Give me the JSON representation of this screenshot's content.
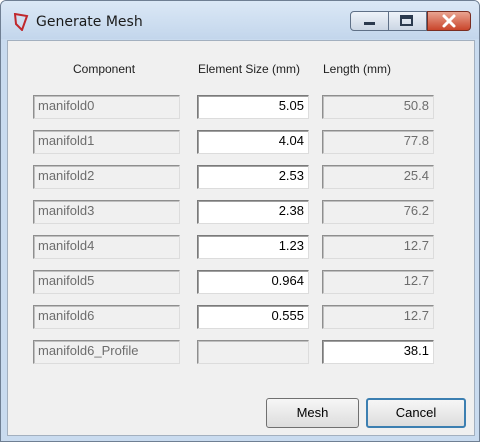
{
  "window": {
    "title": "Generate Mesh"
  },
  "headers": {
    "component": "Component",
    "element_size": "Element Size (mm)",
    "length": "Length (mm)"
  },
  "rows": [
    {
      "component": "manifold0",
      "element_size": "5.05",
      "length": "50.8"
    },
    {
      "component": "manifold1",
      "element_size": "4.04",
      "length": "77.8"
    },
    {
      "component": "manifold2",
      "element_size": "2.53",
      "length": "25.4"
    },
    {
      "component": "manifold3",
      "element_size": "2.38",
      "length": "76.2"
    },
    {
      "component": "manifold4",
      "element_size": "1.23",
      "length": "12.7"
    },
    {
      "component": "manifold5",
      "element_size": "0.964",
      "length": "12.7"
    },
    {
      "component": "manifold6",
      "element_size": "0.555",
      "length": "12.7"
    },
    {
      "component": "manifold6_Profile",
      "element_size": "",
      "length": "38.1"
    }
  ],
  "buttons": {
    "mesh": "Mesh",
    "cancel": "Cancel"
  },
  "icons": {
    "app": "mesh-app-icon",
    "minimize": "minimize-icon",
    "maximize": "maximize-icon",
    "close": "close-icon"
  }
}
